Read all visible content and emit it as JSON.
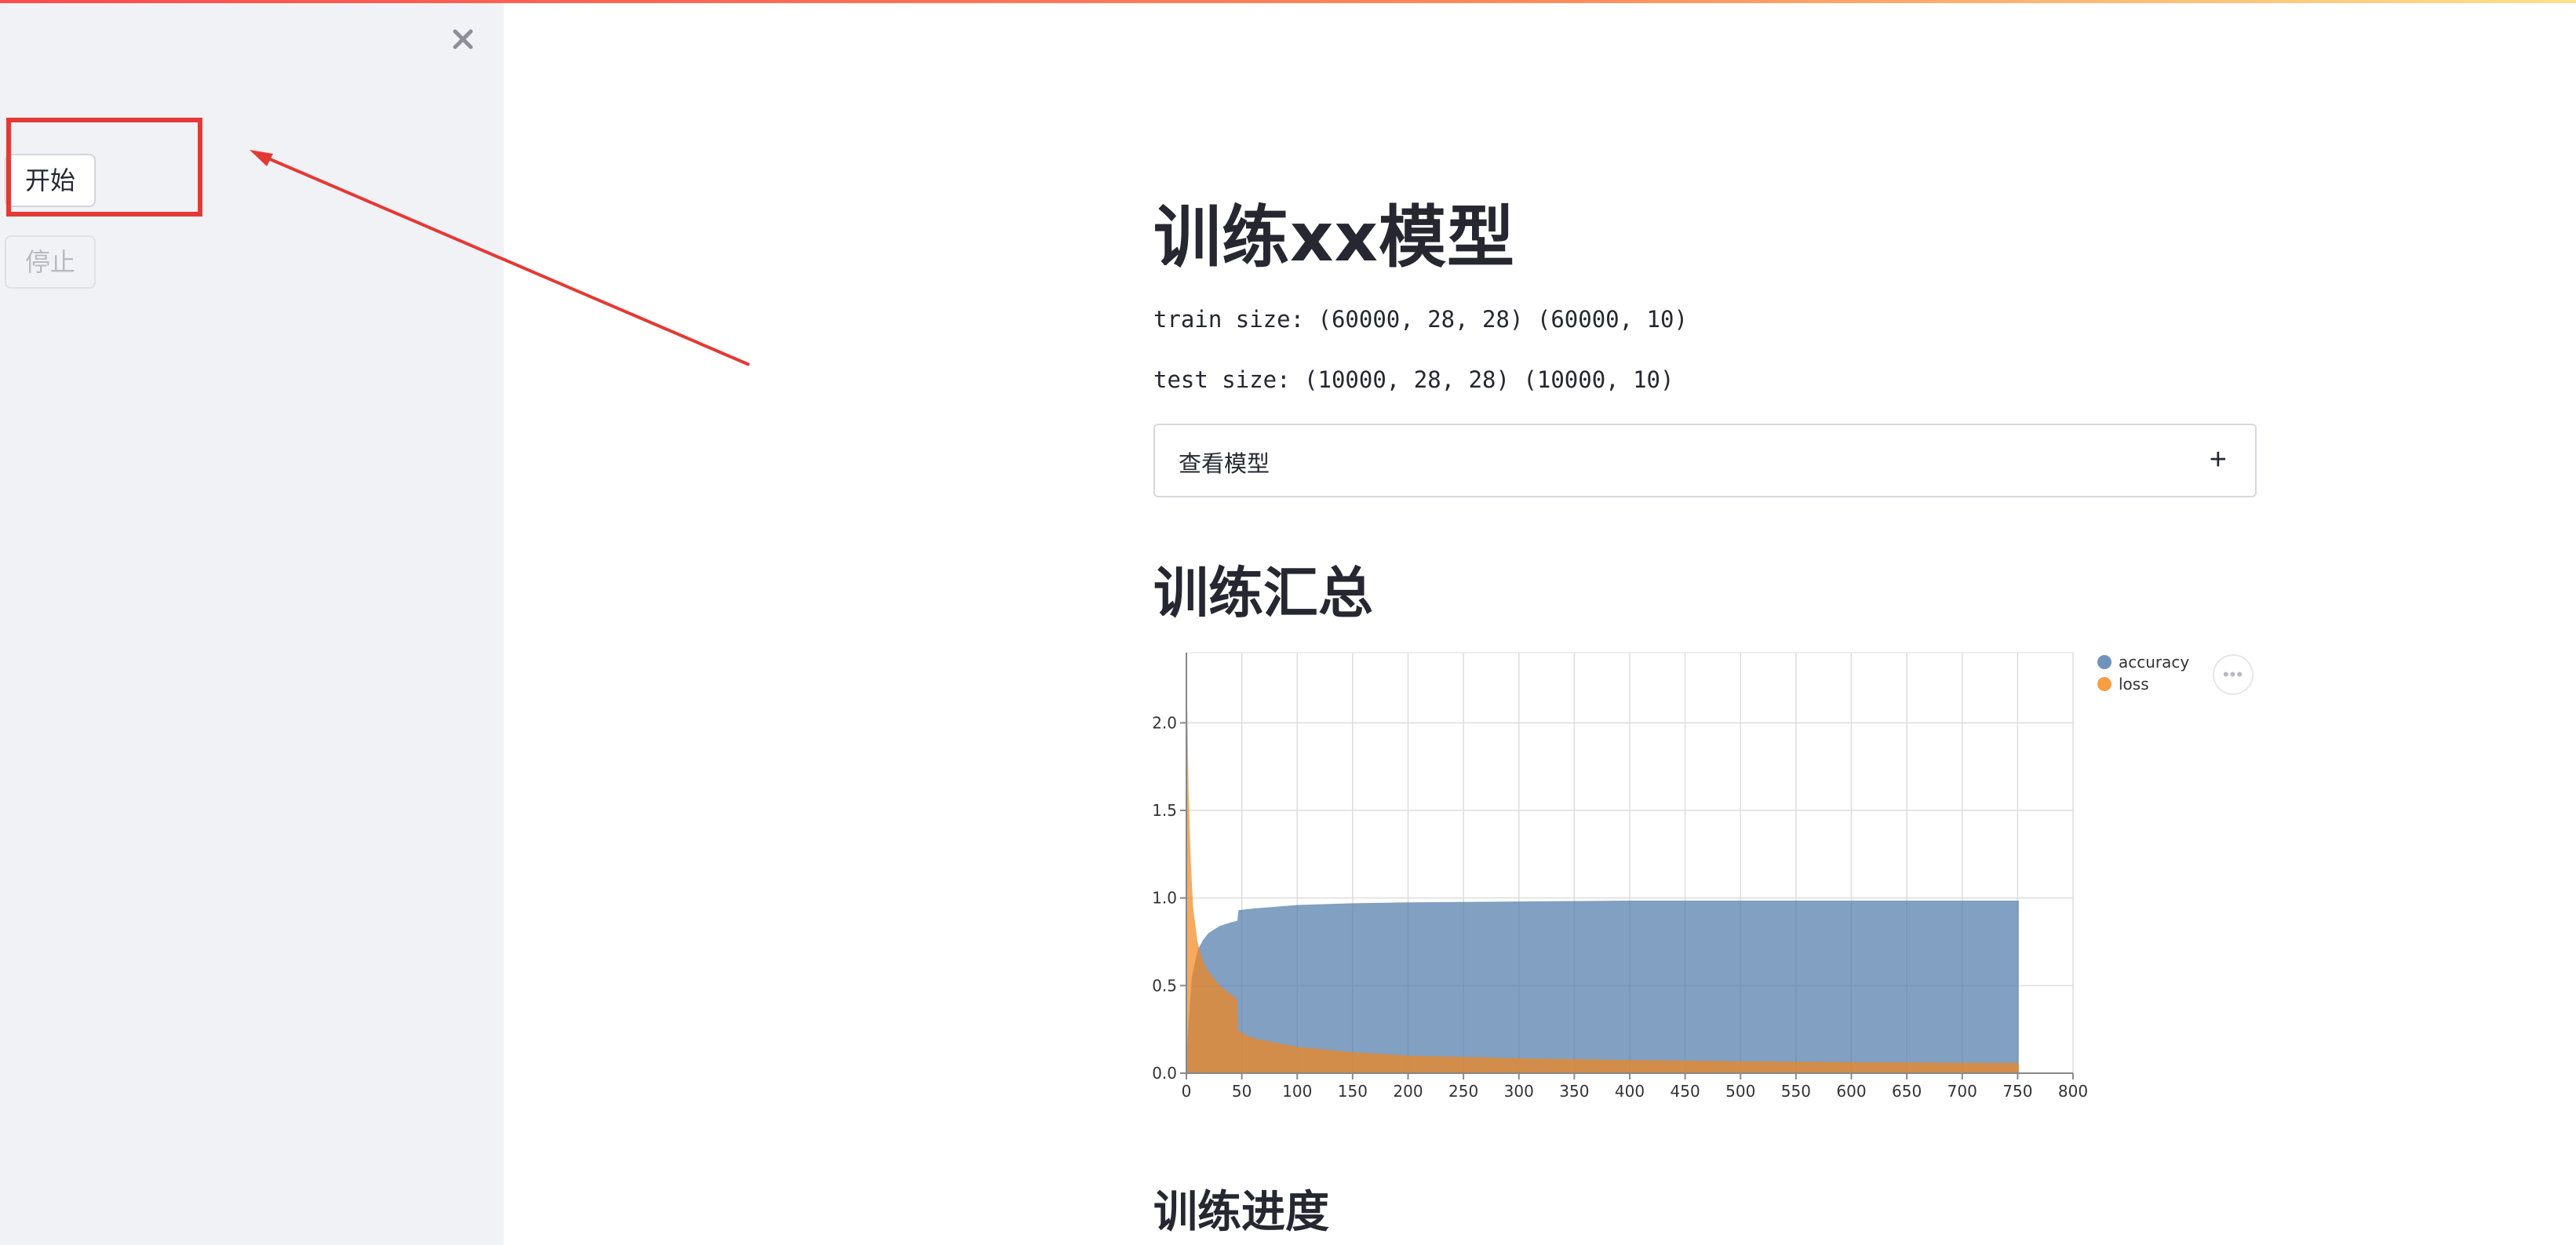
{
  "sidebar": {
    "close_icon": "close-icon",
    "start_label": "开始",
    "stop_label": "停止"
  },
  "main": {
    "title": "训练xx模型",
    "train_size": "train size: (60000, 28, 28) (60000, 10)",
    "test_size": "test size: (10000, 28, 28) (10000, 10)",
    "expander_label": "查看模型",
    "expander_icon": "plus-icon",
    "summary_title": "训练汇总",
    "progress_title": "训练进度",
    "chart_menu_icon": "more-icon"
  },
  "colors": {
    "accent": "#ff4b4b",
    "sidebar_bg": "#f0f2f6",
    "annotation": "#e53935",
    "accuracy": "#4c78a8",
    "loss": "#f58518"
  },
  "chart_data": {
    "type": "area",
    "xlim": [
      0,
      800
    ],
    "ylim": [
      0,
      2.4
    ],
    "x_ticks": [
      0,
      50,
      100,
      150,
      200,
      250,
      300,
      350,
      400,
      450,
      500,
      550,
      600,
      650,
      700,
      750,
      800
    ],
    "y_ticks": [
      0.0,
      0.5,
      1.0,
      1.5,
      2.0
    ],
    "grid": true,
    "legend_position": "right",
    "series": [
      {
        "name": "accuracy",
        "color": "#4c78a8",
        "x": [
          0,
          2,
          5,
          10,
          15,
          20,
          30,
          40,
          46,
          47,
          60,
          100,
          150,
          200,
          300,
          400,
          500,
          600,
          700,
          751
        ],
        "y": [
          0.08,
          0.3,
          0.55,
          0.7,
          0.76,
          0.8,
          0.84,
          0.86,
          0.87,
          0.93,
          0.94,
          0.96,
          0.97,
          0.975,
          0.98,
          0.985,
          0.985,
          0.985,
          0.985,
          0.985
        ]
      },
      {
        "name": "loss",
        "color": "#f58518",
        "x": [
          0,
          1,
          2,
          4,
          6,
          10,
          15,
          20,
          30,
          40,
          46,
          47,
          60,
          100,
          150,
          200,
          300,
          400,
          500,
          600,
          700,
          751
        ],
        "y": [
          2.3,
          2.0,
          1.6,
          1.2,
          0.95,
          0.75,
          0.64,
          0.58,
          0.5,
          0.45,
          0.42,
          0.24,
          0.2,
          0.15,
          0.12,
          0.1,
          0.085,
          0.075,
          0.068,
          0.063,
          0.06,
          0.058
        ]
      }
    ]
  }
}
